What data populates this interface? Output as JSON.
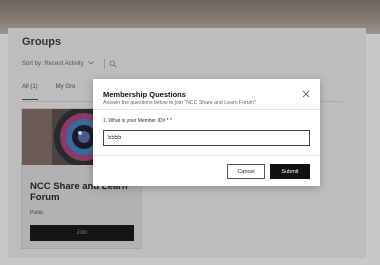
{
  "page": {
    "title": "Groups",
    "sort_label": "Sort by: Recent Activity",
    "tabs": [
      {
        "label": "All (1)"
      },
      {
        "label": "My Gro"
      }
    ]
  },
  "group_card": {
    "title": "NCC Share and Learn Forum",
    "privacy": "Public",
    "join_label": "Join"
  },
  "modal": {
    "title": "Membership Questions",
    "subtitle": "Answer the questions below to join \"NCC Share and Learn Forum\"",
    "question_label": "1. What is your Member ID# * *",
    "answer_value": "5555",
    "cancel_label": "Cancel",
    "submit_label": "Submit"
  },
  "icons": {
    "sort": "chevron-down-icon",
    "search": "search-icon",
    "close": "close-icon"
  },
  "colors": {
    "overlay": "#bdbdbd",
    "modal_bg": "#ffffff",
    "primary_button": "#111111"
  }
}
